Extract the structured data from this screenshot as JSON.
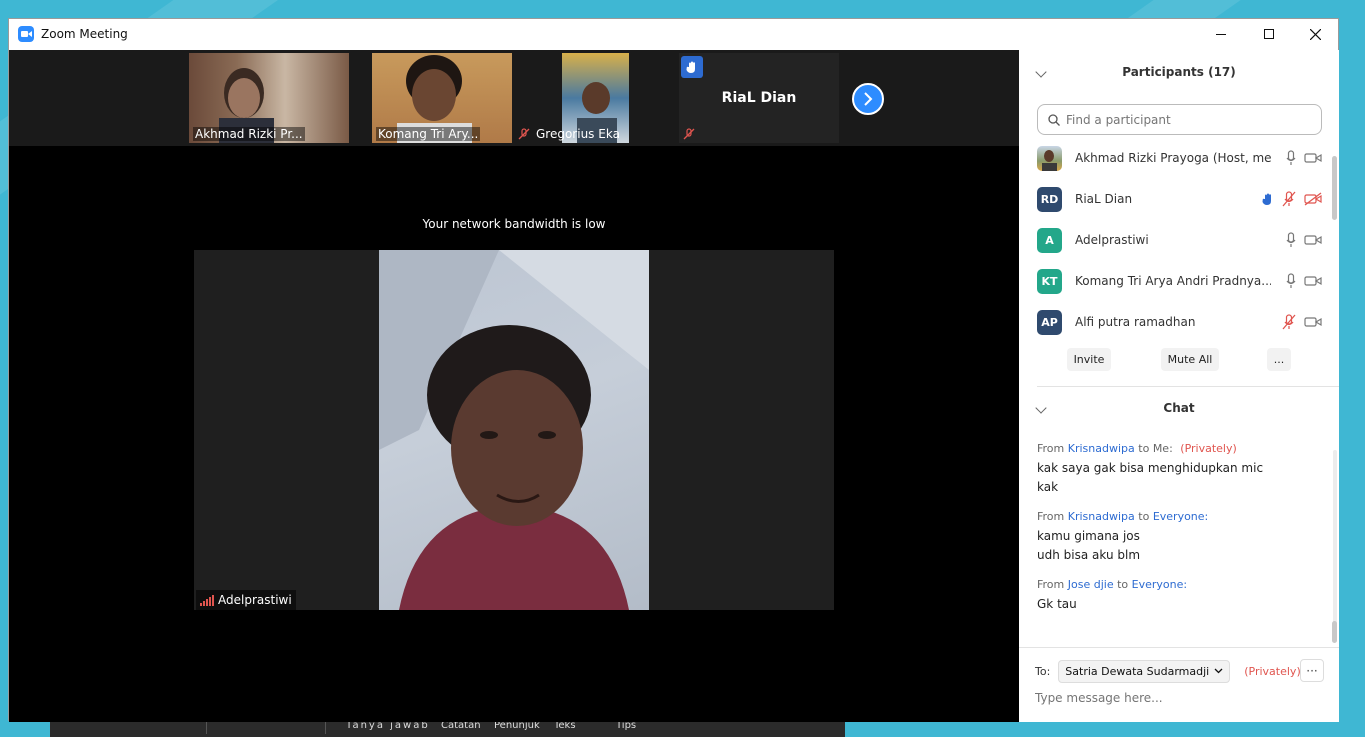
{
  "window": {
    "title": "Zoom Meeting",
    "minimize": "—",
    "maximize": "☐",
    "close": "✕"
  },
  "video_strip": {
    "tiles": [
      {
        "name": "Akhmad Rizki Pr..."
      },
      {
        "name": "Komang Tri Ary..."
      },
      {
        "name": "Gregorius Eka"
      },
      {
        "name": "RiaL Dian"
      }
    ]
  },
  "main": {
    "bandwidth_notice": "Your network bandwidth is low",
    "active_speaker": "Adelprastiwi"
  },
  "taskbar": {
    "items": [
      "Tanya jawab",
      "Catatan",
      "Penunjuk",
      "Teks",
      "Tips"
    ]
  },
  "participants": {
    "header": "Participants (17)",
    "search_placeholder": "Find a participant",
    "list": [
      {
        "initials": "",
        "name": "Akhmad Rizki Prayoga (Host, me)",
        "color": "#8a9a6a"
      },
      {
        "initials": "RD",
        "name": "RiaL Dian",
        "color": "#2f4a6e"
      },
      {
        "initials": "A",
        "name": "Adelprastiwi",
        "color": "#23a78a"
      },
      {
        "initials": "KT",
        "name": "Komang Tri Arya Andri Pradnya...",
        "color": "#23a78a"
      },
      {
        "initials": "AP",
        "name": "Alfi putra ramadhan",
        "color": "#2f4a6e"
      }
    ],
    "buttons": {
      "invite": "Invite",
      "mute_all": "Mute All",
      "more": "..."
    }
  },
  "chat": {
    "header": "Chat",
    "messages": [
      {
        "from_label": "From",
        "sender": "Krisnadwipa",
        "to_label": "to",
        "recipient": "Me:",
        "privately": "(Privately)",
        "lines": [
          "kak saya gak bisa menghidupkan mic",
          "kak"
        ]
      },
      {
        "from_label": "From",
        "sender": "Krisnadwipa",
        "to_label": "to",
        "recipient": "Everyone:",
        "privately": "",
        "lines": [
          "kamu gimana jos",
          "udh bisa aku blm"
        ]
      },
      {
        "from_label": "From",
        "sender": "Jose djie",
        "to_label": "to",
        "recipient": "Everyone:",
        "privately": "",
        "lines": [
          "Gk tau"
        ]
      }
    ],
    "to_label": "To:",
    "to_recipient": "Satria Dewata Sudarmadji",
    "to_privately": "(Privately)",
    "more": "···",
    "input_placeholder": "Type message here..."
  },
  "colors": {
    "accent": "#2d8cff",
    "muted_red": "#e0554f",
    "background": "#3fb7d3"
  }
}
